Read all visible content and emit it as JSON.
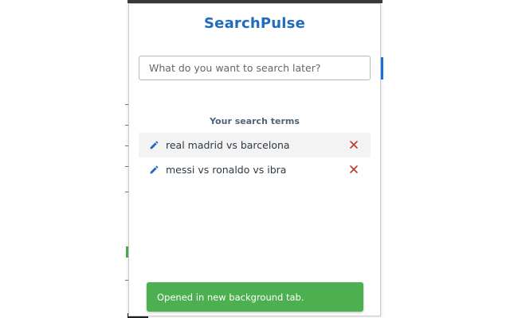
{
  "app": {
    "title": "SearchPulse"
  },
  "search": {
    "placeholder": "What do you want to search later?",
    "value": ""
  },
  "terms_section": {
    "heading": "Your search terms",
    "items": [
      {
        "label": "real madrid vs barcelona",
        "edit_icon": "pencil-icon",
        "delete_icon": "close-icon"
      },
      {
        "label": "messi vs ronaldo vs ibra",
        "edit_icon": "pencil-icon",
        "delete_icon": "close-icon"
      }
    ]
  },
  "toast": {
    "message": "Opened in new background tab."
  },
  "colors": {
    "brand": "#1e6bc0",
    "edit_icon": "#1e6bc0",
    "delete_icon": "#c0392b",
    "toast_bg": "#4caf50"
  }
}
